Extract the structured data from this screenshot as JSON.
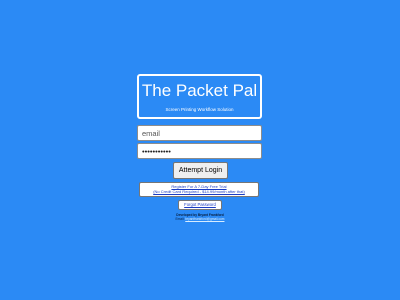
{
  "app": {
    "title": "The Packet Pal",
    "subtitle": "Screen Printing Workflow Solution"
  },
  "login_form": {
    "email_placeholder": "email",
    "password_value": "•••••••••••",
    "submit_label": "Attempt Login"
  },
  "links": {
    "register_line1": "Register For A 7-Day Free Trial",
    "register_line2": "(No Credit Card Required - $14.99/month after that)",
    "forgot_password": "Forgot Password"
  },
  "footer": {
    "developer": "Developed by Bryant Frankford",
    "email_label": "Email:",
    "email_address": "bryantfrankford@gmail.com"
  },
  "colors": {
    "background": "#2b8af5",
    "link": "#1a3cc4"
  }
}
